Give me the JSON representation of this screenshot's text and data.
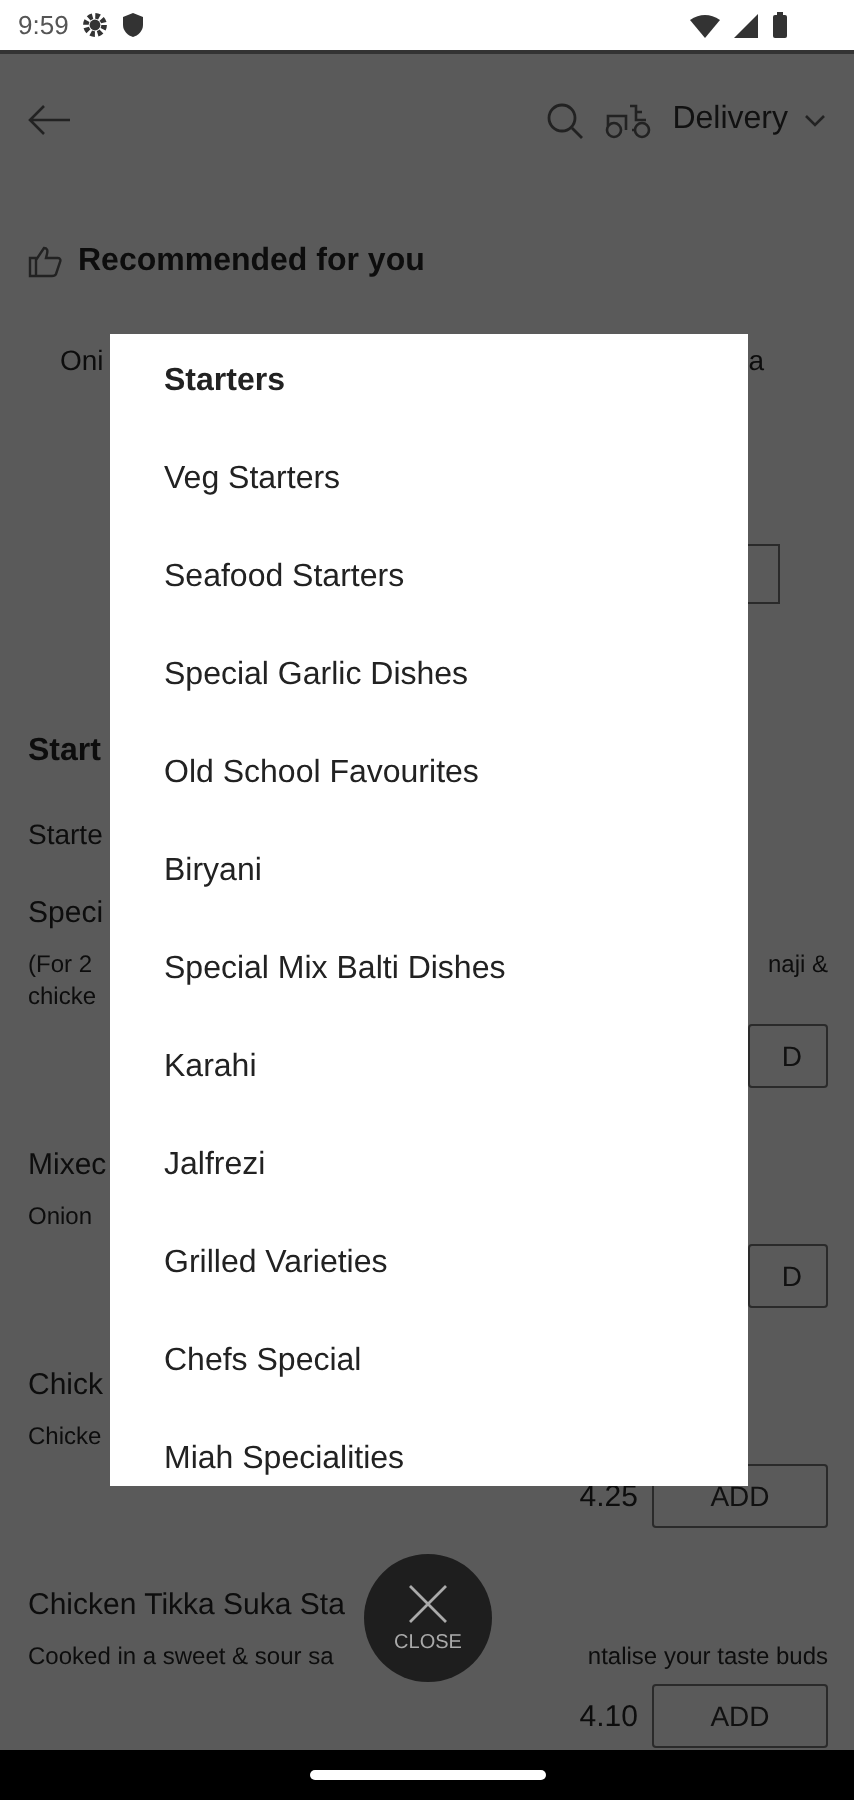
{
  "status_bar": {
    "time": "9:59"
  },
  "header": {
    "delivery_mode": "Delivery"
  },
  "recommended": {
    "title": "Recommended for you",
    "card_left": "Oni",
    "card_right": "a"
  },
  "background_items": [
    {
      "kind": "heading",
      "name": "Start"
    },
    {
      "kind": "subheading",
      "name": "Starte"
    },
    {
      "kind": "dish",
      "name": "Speci",
      "description": [
        "(For 2",
        "chicke"
      ],
      "description_right": "naji &",
      "button_text": "D"
    },
    {
      "kind": "dish",
      "name": "Mixec",
      "description": [
        "Onion"
      ],
      "button_text": "D"
    },
    {
      "kind": "dish",
      "name": "Chick",
      "description": [
        "Chicke"
      ],
      "price": "4.25",
      "button_text": "ADD"
    },
    {
      "kind": "dish",
      "name": "Chicken Tikka Suka Sta",
      "description": [
        "Cooked in a sweet & sour sa"
      ],
      "description_right": "ntalise your taste buds",
      "price": "4.10",
      "button_text": "ADD"
    }
  ],
  "category_menu": {
    "items": [
      {
        "label": "Starters",
        "selected": true
      },
      {
        "label": "Veg Starters",
        "selected": false
      },
      {
        "label": "Seafood Starters",
        "selected": false
      },
      {
        "label": "Special Garlic Dishes",
        "selected": false
      },
      {
        "label": "Old School Favourites",
        "selected": false
      },
      {
        "label": "Biryani",
        "selected": false
      },
      {
        "label": "Special Mix Balti Dishes",
        "selected": false
      },
      {
        "label": "Karahi",
        "selected": false
      },
      {
        "label": "Jalfrezi",
        "selected": false
      },
      {
        "label": "Grilled Varieties",
        "selected": false
      },
      {
        "label": "Chefs Special",
        "selected": false
      },
      {
        "label": "Miah Specialities",
        "selected": false
      }
    ]
  },
  "close_button": {
    "label": "CLOSE"
  }
}
